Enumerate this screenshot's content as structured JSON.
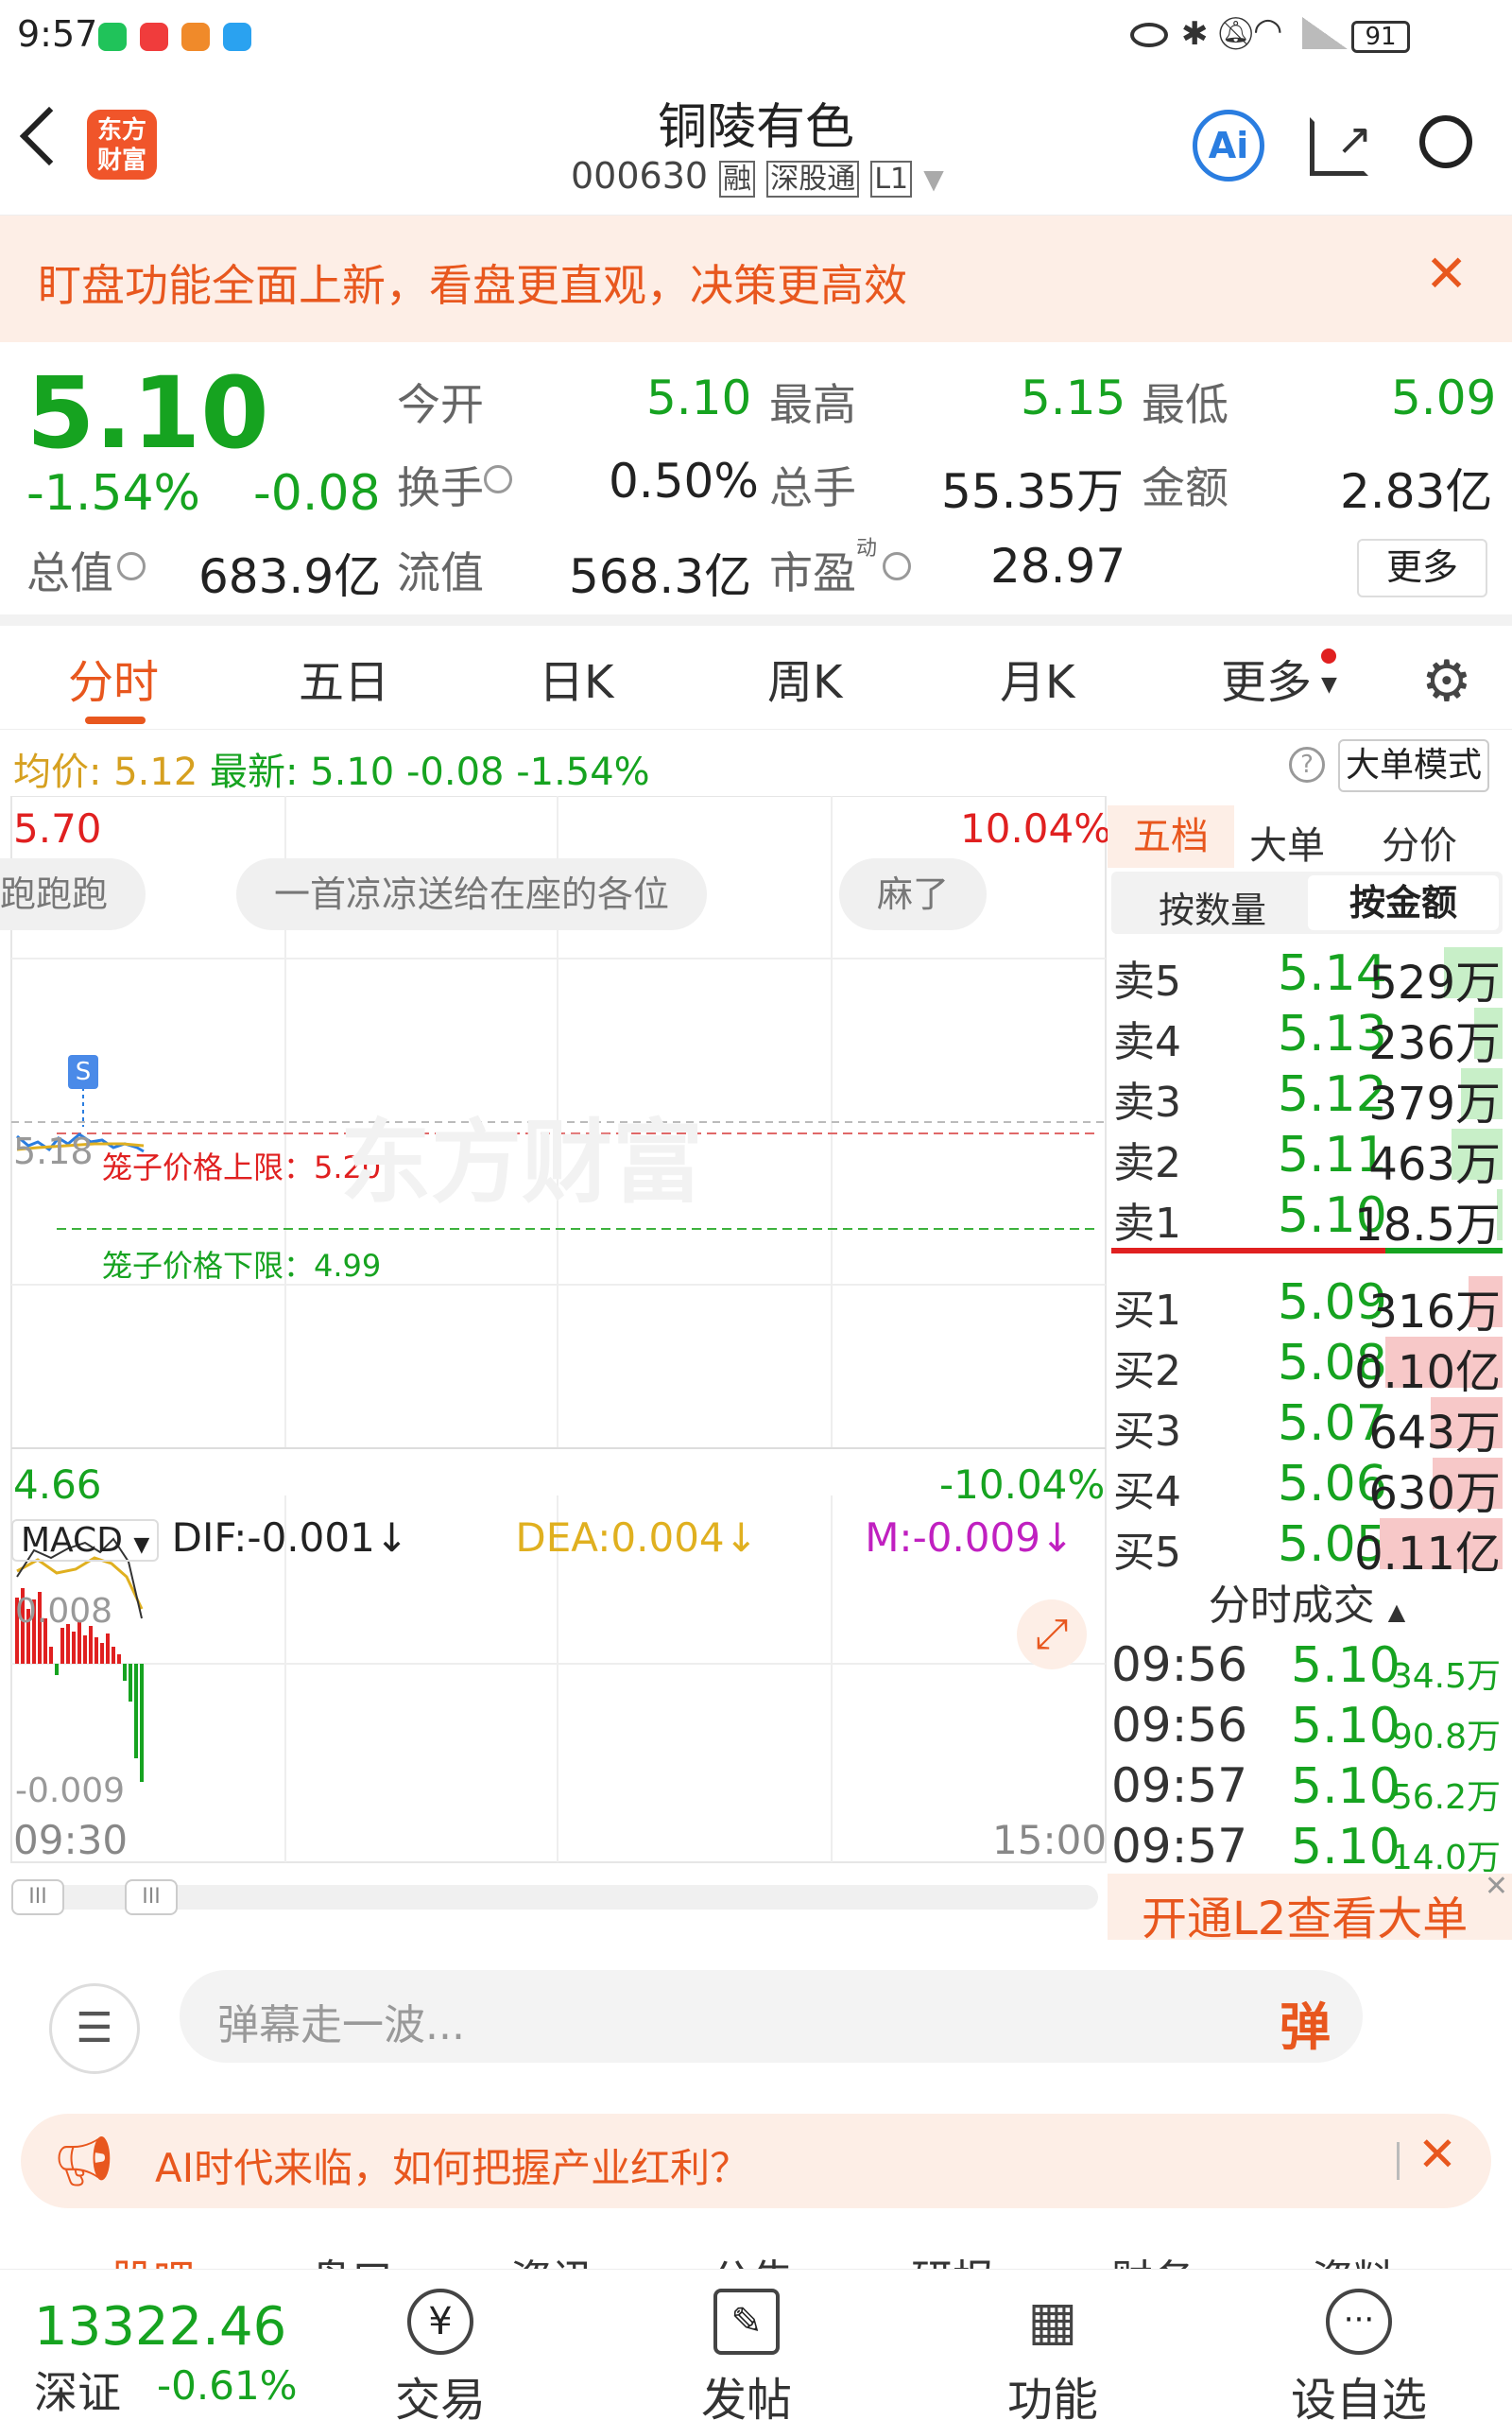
{
  "status_bar": {
    "time": "9:57",
    "battery": "91"
  },
  "header": {
    "title": "铜陵有色",
    "code": "000630",
    "tags": [
      "融",
      "深股通",
      "L1"
    ],
    "logo_text_1": "东方",
    "logo_text_2": "财富",
    "ai_label": "Ai"
  },
  "banner": {
    "text": "盯盘功能全面上新，看盘更直观，决策更高效"
  },
  "quote": {
    "price": "5.10",
    "change_pct": "-1.54%",
    "change": "-0.08",
    "open_label": "今开",
    "open": "5.10",
    "high_label": "最高",
    "high": "5.15",
    "low_label": "最低",
    "low": "5.09",
    "turnover_label": "换手",
    "turnover": "0.50%",
    "volume_label": "总手",
    "volume": "55.35万",
    "amount_label": "金额",
    "amount": "2.83亿",
    "total_mv_label": "总值",
    "total_mv": "683.9亿",
    "float_mv_label": "流值",
    "float_mv": "568.3亿",
    "pe_label": "市盈",
    "pe_sup": "动",
    "pe": "28.97",
    "more_label": "更多"
  },
  "tabs": [
    "分时",
    "五日",
    "日K",
    "周K",
    "月K",
    "更多"
  ],
  "chart_header": {
    "avg_label": "均价:",
    "avg": "5.12",
    "last_label": "最新:",
    "last": "5.10",
    "chg": "-0.08",
    "chg_pct": "-1.54%",
    "big_order_mode": "大单模式"
  },
  "chart": {
    "y_top": "5.70",
    "y_top_pct": "10.04%",
    "y_bottom": "4.66",
    "y_bottom_pct": "-10.04%",
    "y_mid": "5.18",
    "cage_upper": "笼子价格上限：5.20",
    "cage_lower": "笼子价格下限：4.99",
    "x_start": "09:30",
    "x_end": "15:00",
    "watermark": "东方财富",
    "signal_marker": "S"
  },
  "danmaku": [
    "跑跑跑",
    "一首凉凉送给在座的各位",
    "麻了"
  ],
  "macd": {
    "label": "MACD",
    "dif": "DIF:-0.001↓",
    "dea": "DEA:0.004↓",
    "m": "M:-0.009↓",
    "top": "0.008",
    "bottom": "-0.009"
  },
  "order_book": {
    "tabs": [
      "五档",
      "大单",
      "分价"
    ],
    "subtabs": [
      "按数量",
      "按金额"
    ],
    "asks": [
      {
        "label": "卖5",
        "price": "5.14",
        "vol": "529万"
      },
      {
        "label": "卖4",
        "price": "5.13",
        "vol": "236万"
      },
      {
        "label": "卖3",
        "price": "5.12",
        "vol": "379万"
      },
      {
        "label": "卖2",
        "price": "5.11",
        "vol": "463万"
      },
      {
        "label": "卖1",
        "price": "5.10",
        "vol": "18.5万"
      }
    ],
    "bids": [
      {
        "label": "买1",
        "price": "5.09",
        "vol": "316万"
      },
      {
        "label": "买2",
        "price": "5.08",
        "vol": "0.10亿"
      },
      {
        "label": "买3",
        "price": "5.07",
        "vol": "643万"
      },
      {
        "label": "买4",
        "price": "5.06",
        "vol": "630万"
      },
      {
        "label": "买5",
        "price": "5.05",
        "vol": "0.11亿"
      }
    ],
    "trades_title": "分时成交",
    "trades": [
      {
        "time": "09:56",
        "price": "5.10",
        "vol": "34.5万"
      },
      {
        "time": "09:56",
        "price": "5.10",
        "vol": "90.8万"
      },
      {
        "time": "09:57",
        "price": "5.10",
        "vol": "56.2万"
      },
      {
        "time": "09:57",
        "price": "5.10",
        "vol": "14.0万"
      }
    ],
    "l2_promo": "开通L2查看大单"
  },
  "comment": {
    "placeholder": "弹幕走一波...",
    "send_label": "弹"
  },
  "ai_banner": {
    "text": "AI时代来临，如何把握产业红利？"
  },
  "section_tabs": [
    "股吧",
    "盘口",
    "资讯",
    "公告",
    "研报",
    "财务",
    "资料"
  ],
  "bottom_nav": {
    "index_value": "13322.46",
    "index_name": "深证",
    "index_change": "-0.61%",
    "items": [
      "交易",
      "发帖",
      "功能",
      "设自选"
    ]
  }
}
